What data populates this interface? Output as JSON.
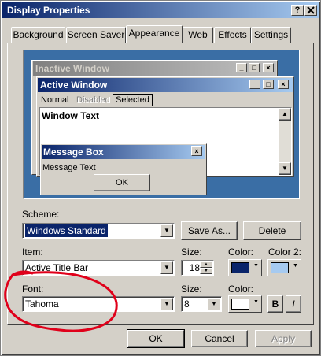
{
  "window": {
    "title": "Display Properties",
    "help_button": "?",
    "close_button": "X"
  },
  "tabs": [
    {
      "label": "Background",
      "active": false
    },
    {
      "label": "Screen Saver",
      "active": false
    },
    {
      "label": "Appearance",
      "active": true
    },
    {
      "label": "Web",
      "active": false
    },
    {
      "label": "Effects",
      "active": false
    },
    {
      "label": "Settings",
      "active": false
    }
  ],
  "preview": {
    "inactive_window_title": "Inactive Window",
    "active_window_title": "Active Window",
    "menu_items": [
      "Normal",
      "Disabled",
      "Selected"
    ],
    "window_text": "Window Text",
    "message_box_title": "Message Box",
    "message_text": "Message Text",
    "ok_label": "OK",
    "colors": {
      "desktop": "#3a6ea5",
      "active_title": "#0a246a",
      "inactive_title": "#808080",
      "selected_menu_border": "#000000"
    }
  },
  "scheme": {
    "label": "Scheme:",
    "value": "Windows Standard",
    "save_as_label": "Save As...",
    "delete_label": "Delete"
  },
  "item": {
    "label": "Item:",
    "value": "Active Title Bar",
    "size_label": "Size:",
    "size_value": "18",
    "color_label": "Color:",
    "color_value": "#0a246a",
    "color2_label": "Color 2:",
    "color2_value": "#a6caf0"
  },
  "font": {
    "label": "Font:",
    "value": "Tahoma",
    "size_label": "Size:",
    "size_value": "8",
    "color_label": "Color:",
    "color_value": "#ffffff",
    "bold_label": "B",
    "italic_label": "I"
  },
  "buttons": {
    "ok": "OK",
    "cancel": "Cancel",
    "apply": "Apply"
  },
  "annotation": {
    "color": "#e0001a",
    "shape": "freehand-circle"
  }
}
